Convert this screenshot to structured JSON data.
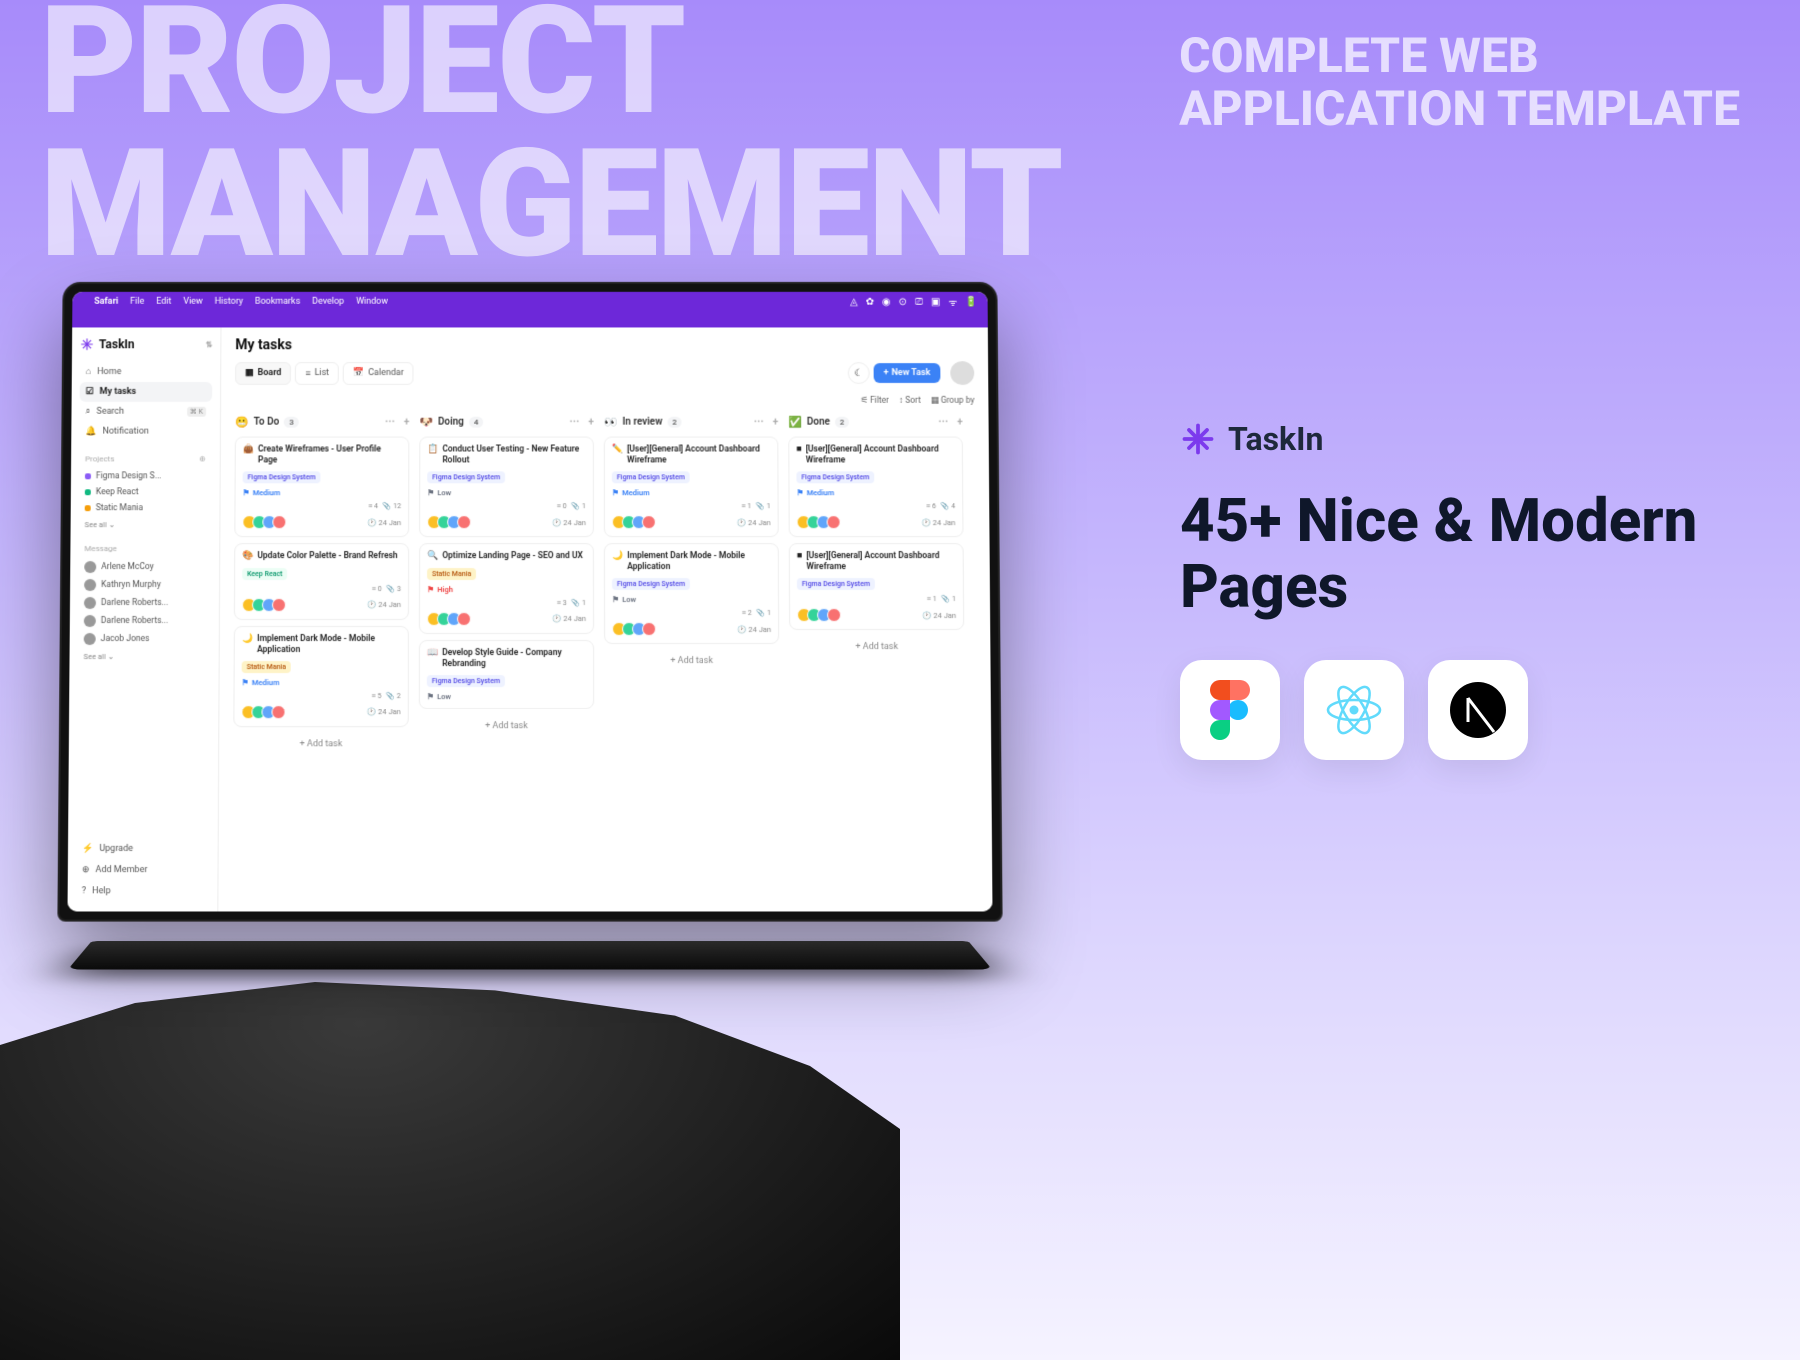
{
  "hero": {
    "line1": "PROJECT",
    "line2": "MANAGEMENT",
    "sub1": "COMPLETE WEB",
    "sub2": "APPLICATION TEMPLATE"
  },
  "menubar": {
    "app": "Safari",
    "items": [
      "File",
      "Edit",
      "View",
      "History",
      "Bookmarks",
      "Develop",
      "Window"
    ]
  },
  "brand": "TaskIn",
  "nav": [
    {
      "icon": "⌂",
      "label": "Home"
    },
    {
      "icon": "☑",
      "label": "My tasks",
      "active": true
    },
    {
      "icon": "⌕",
      "label": "Search",
      "kbd": "⌘ K"
    },
    {
      "icon": "🔔",
      "label": "Notification"
    }
  ],
  "projects_label": "Projects",
  "projects": [
    {
      "color": "#8b5cf6",
      "label": "Figma Design S..."
    },
    {
      "color": "#10b981",
      "label": "Keep React"
    },
    {
      "color": "#f59e0b",
      "label": "Static Mania"
    }
  ],
  "see_all": "See all",
  "messages_label": "Message",
  "messages": [
    "Arlene McCoy",
    "Kathryn Murphy",
    "Darlene Roberts...",
    "Darlene Roberts...",
    "Jacob Jones"
  ],
  "footer": [
    {
      "icon": "⚡",
      "label": "Upgrade"
    },
    {
      "icon": "⊕",
      "label": "Add Member"
    },
    {
      "icon": "?",
      "label": "Help"
    }
  ],
  "page_title": "My tasks",
  "views": [
    {
      "icon": "▦",
      "label": "Board",
      "active": true
    },
    {
      "icon": "≡",
      "label": "List"
    },
    {
      "icon": "📅",
      "label": "Calendar"
    }
  ],
  "new_task": "New Task",
  "filters": {
    "filter": "Filter",
    "sort": "Sort",
    "group": "Group by"
  },
  "columns": [
    {
      "emoji": "😬",
      "name": "To Do",
      "count": 3,
      "cards": [
        {
          "ci": "👜",
          "title": "Create Wireframes - User Profile Page",
          "tags": [
            {
              "t": "Figma Design System",
              "c": "tag"
            }
          ],
          "prio": "Medium",
          "sub": 4,
          "att": 12,
          "date": "24 Jan"
        },
        {
          "ci": "🎨",
          "title": "Update Color Palette - Brand Refresh",
          "tags": [
            {
              "t": "Keep React",
              "c": "tag keep"
            }
          ],
          "prio": "",
          "sub": 0,
          "att": 3,
          "date": "24 Jan"
        },
        {
          "ci": "🌙",
          "title": "Implement Dark Mode - Mobile Application",
          "tags": [
            {
              "t": "Static Mania",
              "c": "tag static"
            }
          ],
          "prio": "Medium",
          "sub": 5,
          "att": 2,
          "date": "24 Jan"
        }
      ]
    },
    {
      "emoji": "🐶",
      "name": "Doing",
      "count": 4,
      "cards": [
        {
          "ci": "📋",
          "title": "Conduct User Testing - New Feature Rollout",
          "tags": [
            {
              "t": "Figma Design System",
              "c": "tag"
            }
          ],
          "prio": "Low",
          "sub": 0,
          "att": 1,
          "date": "24 Jan"
        },
        {
          "ci": "🔍",
          "title": "Optimize Landing Page - SEO and UX",
          "tags": [
            {
              "t": "Static Mania",
              "c": "tag static"
            }
          ],
          "prio": "High",
          "sub": 3,
          "att": 1,
          "date": "24 Jan"
        },
        {
          "ci": "📖",
          "title": "Develop Style Guide - Company Rebranding",
          "tags": [
            {
              "t": "Figma Design System",
              "c": "tag"
            }
          ],
          "prio": "Low",
          "sub": "",
          "att": "",
          "date": ""
        }
      ]
    },
    {
      "emoji": "👀",
      "name": "In review",
      "count": 2,
      "cards": [
        {
          "ci": "✏️",
          "title": "[User][General] Account Dashboard Wireframe",
          "tags": [
            {
              "t": "Figma Design System",
              "c": "tag"
            }
          ],
          "prio": "Medium",
          "sub": 1,
          "att": 1,
          "date": "24 Jan"
        },
        {
          "ci": "🌙",
          "title": "Implement Dark Mode - Mobile Application",
          "tags": [
            {
              "t": "Figma Design System",
              "c": "tag"
            }
          ],
          "prio": "Low",
          "sub": 2,
          "att": 1,
          "date": "24 Jan"
        }
      ]
    },
    {
      "emoji": "✅",
      "name": "Done",
      "count": 2,
      "cards": [
        {
          "ci": "■",
          "title": "[User][General] Account Dashboard Wireframe",
          "tags": [
            {
              "t": "Figma Design System",
              "c": "tag"
            }
          ],
          "prio": "Medium",
          "sub": 6,
          "att": 4,
          "date": "24 Jan"
        },
        {
          "ci": "■",
          "title": "[User][General] Account Dashboard Wireframe",
          "tags": [
            {
              "t": "Figma Design System",
              "c": "tag"
            }
          ],
          "prio": "",
          "sub": 1,
          "att": 1,
          "date": "24 Jan"
        }
      ]
    }
  ],
  "add_task": "+ Add task",
  "marketing": {
    "brand": "TaskIn",
    "headline": "45+ Nice & Modern Pages"
  }
}
